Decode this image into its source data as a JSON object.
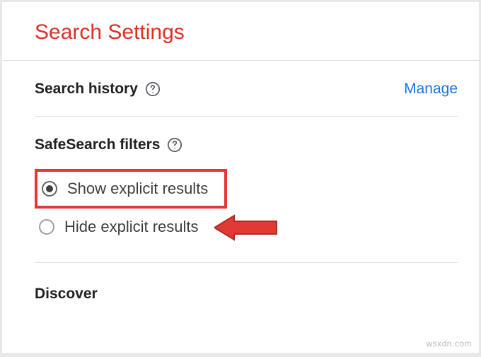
{
  "page_title": "Search Settings",
  "sections": {
    "search_history": {
      "title": "Search history",
      "manage_link": "Manage"
    },
    "safesearch": {
      "title": "SafeSearch filters",
      "options": [
        {
          "label": "Show explicit results",
          "selected": true
        },
        {
          "label": "Hide explicit results",
          "selected": false
        }
      ]
    },
    "discover": {
      "title": "Discover"
    }
  },
  "watermark": "wsxdn.com"
}
